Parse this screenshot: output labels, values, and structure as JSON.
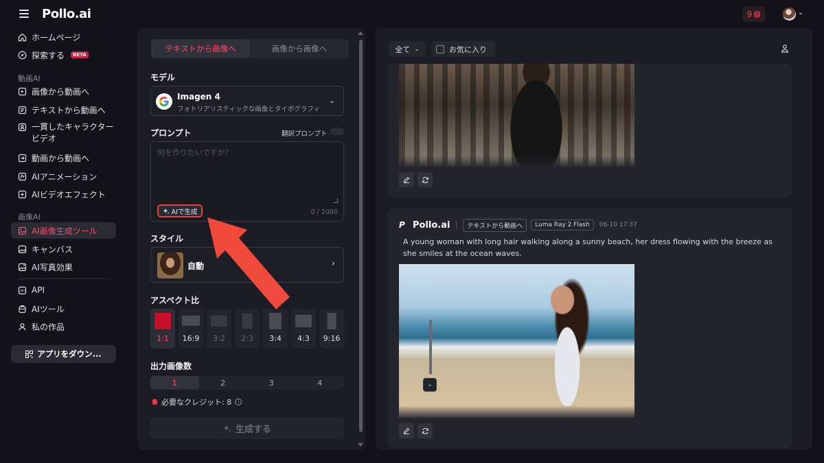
{
  "header": {
    "logo": "Pollo.ai",
    "credits": "9",
    "accent_color": "#ff3b5c"
  },
  "sidebar": {
    "items": [
      {
        "label": "ホームページ",
        "icon": "home-icon"
      },
      {
        "label": "探索する",
        "icon": "compass-icon",
        "badge": "BETA"
      },
      {
        "label": "画像から動画へ",
        "icon": "image-video-icon"
      },
      {
        "label": "テキストから動画へ",
        "icon": "text-video-icon"
      },
      {
        "label": "一貫したキャラクター",
        "label2": "ビデオ",
        "icon": "character-icon"
      },
      {
        "label": "動画から動画へ",
        "icon": "video-video-icon"
      },
      {
        "label": "AIアニメーション",
        "icon": "animation-icon"
      },
      {
        "label": "AIビデオエフェクト",
        "icon": "effect-icon"
      },
      {
        "label": "AI画像生成ツール",
        "icon": "image-gen-icon"
      },
      {
        "label": "キャンバス",
        "icon": "canvas-icon"
      },
      {
        "label": "AI写真効果",
        "icon": "photo-effect-icon"
      },
      {
        "label": "API",
        "icon": "api-icon"
      },
      {
        "label": "AIツール",
        "icon": "tools-icon"
      },
      {
        "label": "私の作品",
        "icon": "works-icon"
      }
    ],
    "section_video": "動画AI",
    "section_image": "画像AI",
    "app_button": "アプリをダウン..."
  },
  "generator": {
    "tabs": [
      "テキストから画像へ",
      "画像から画像へ"
    ],
    "model_label": "モデル",
    "model_name": "Imagen 4",
    "model_desc": "フォトリアリスティックな画像とタイポグラフィ",
    "prompt_label": "プロンプト",
    "translate_label": "翻訳プロンプト",
    "prompt_placeholder": "何を作りたいですか？",
    "ai_generate": "AIで生成",
    "char_count": "0 / 2000",
    "style_label": "スタイル",
    "style_value": "自動",
    "aspect_label": "アスペクト比",
    "ratios": [
      "1:1",
      "16:9",
      "3:2",
      "2:3",
      "3:4",
      "4:3",
      "9:16"
    ],
    "selected_ratio": "1:1",
    "count_label": "出力画像数",
    "counts": [
      "1",
      "2",
      "3",
      "4"
    ],
    "selected_count": "1",
    "credits_needed": "必要なクレジット: 8",
    "generate_button": "生成する"
  },
  "feed": {
    "filter": "全て",
    "favorites": "お気に入り",
    "card2": {
      "brand": "Pollo.ai",
      "mode": "テキストから動画へ",
      "model": "Luma Ray 2 Flash",
      "time": "06-10 17:37",
      "prompt": "A young woman with long hair walking along a sunny beach, her dress flowing with the breeze as she smiles at the ocean waves."
    }
  }
}
